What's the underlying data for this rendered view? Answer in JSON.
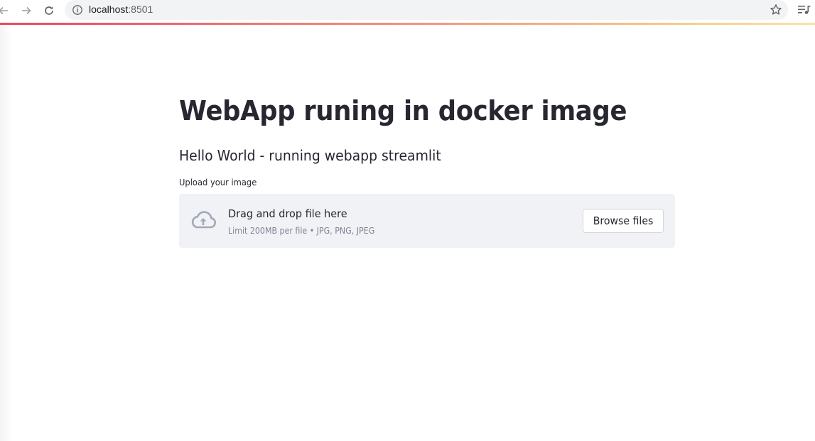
{
  "browser": {
    "url_host": "localhost",
    "url_port": ":8501",
    "icons": {
      "back": "back-arrow-icon",
      "forward": "forward-arrow-icon",
      "reload": "reload-icon",
      "info": "info-icon",
      "bookmark": "star-icon",
      "media": "media-playlist-icon"
    }
  },
  "app": {
    "title": "WebApp runing in docker image",
    "subtitle": "Hello World - running webapp streamlit",
    "uploader": {
      "label": "Upload your image",
      "instructions": "Drag and drop file here",
      "limit_text": "Limit 200MB per file • JPG, PNG, JPEG",
      "browse_label": "Browse files",
      "icon": "cloud-upload-icon"
    }
  },
  "colors": {
    "text": "#262730",
    "muted_text": "#808495",
    "dropzone_bg": "#f0f2f6",
    "accent_gradient_start": "#e8485f",
    "accent_gradient_end": "#fbe3a4"
  }
}
